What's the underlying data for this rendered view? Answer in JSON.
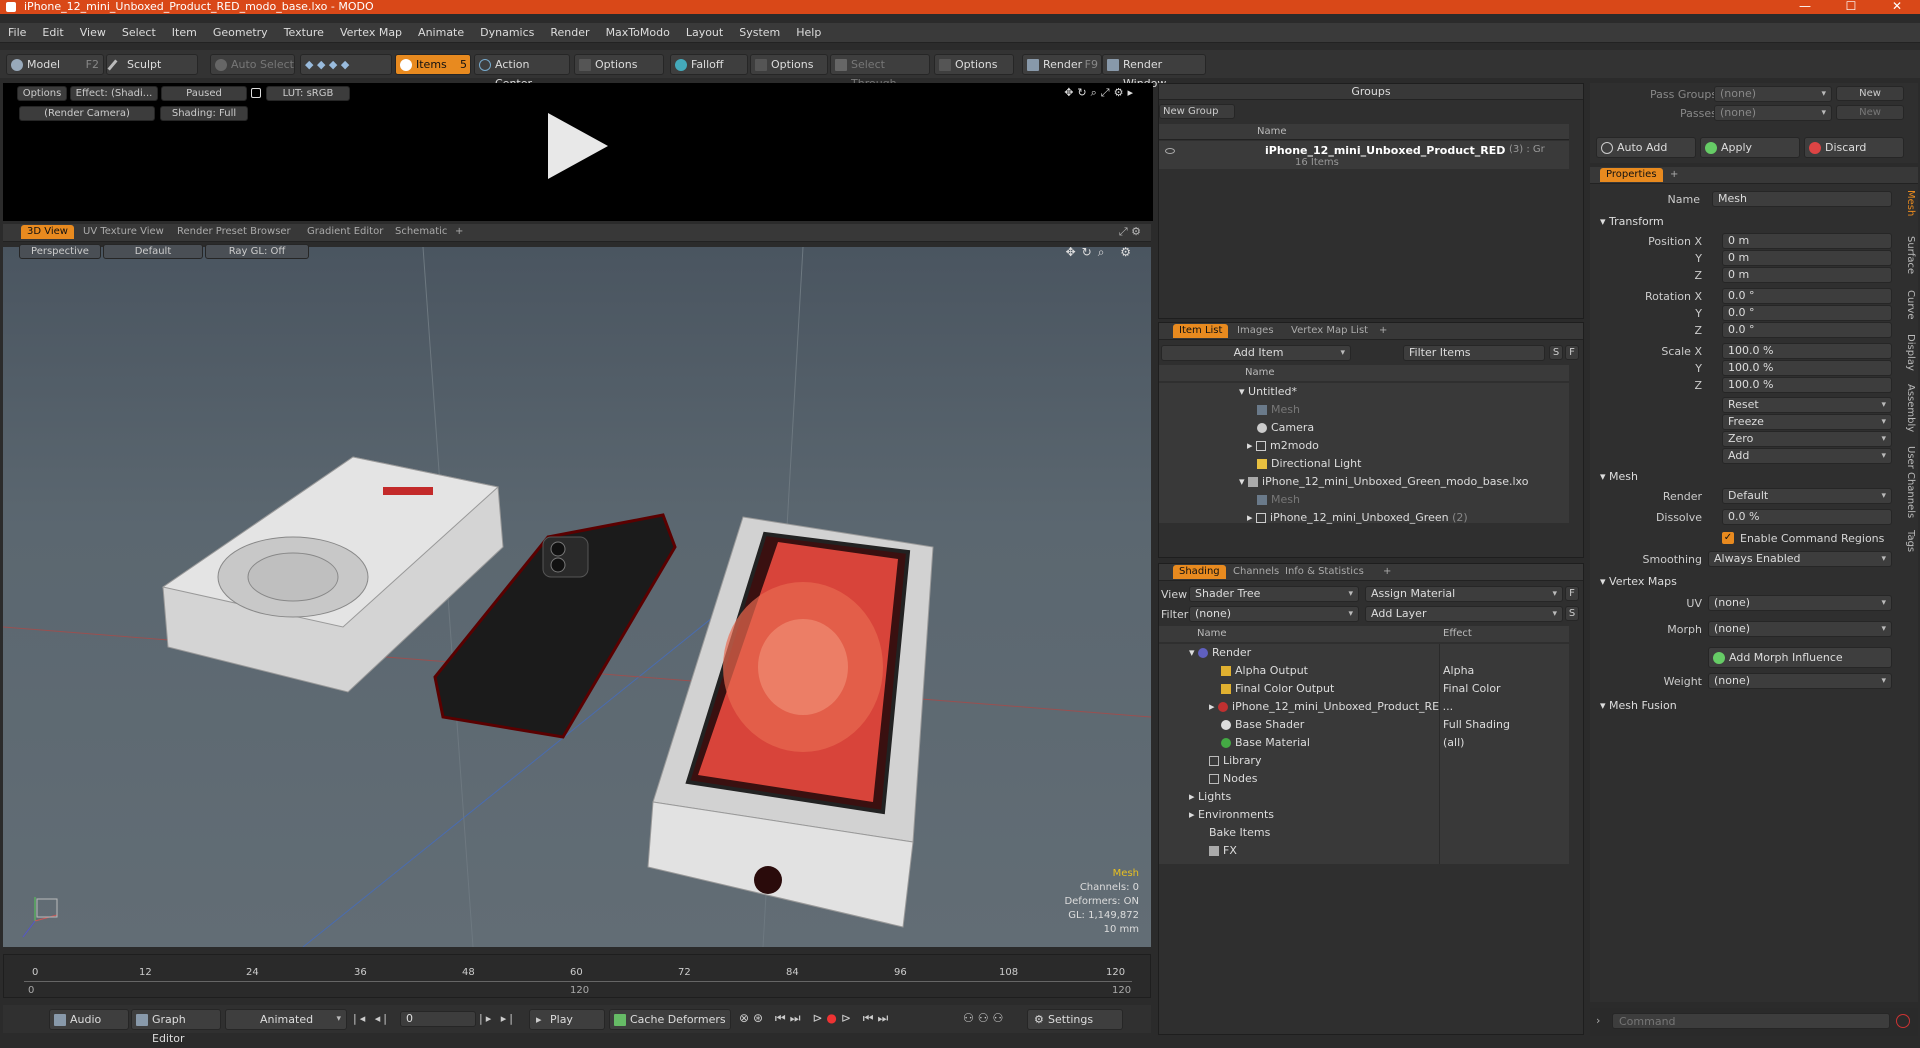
{
  "titlebar": {
    "title": "iPhone_12_mini_Unboxed_Product_RED_modo_base.lxo - MODO",
    "min": "—",
    "max": "☐",
    "close": "✕"
  },
  "menu": [
    "File",
    "Edit",
    "View",
    "Select",
    "Item",
    "Geometry",
    "Texture",
    "Vertex Map",
    "Animate",
    "Dynamics",
    "Render",
    "MaxToModo",
    "Layout",
    "System",
    "Help"
  ],
  "toolbar": {
    "model": "Model",
    "model_key": "F2",
    "sculpt": "Sculpt",
    "auto_select": "Auto Select",
    "items": "Items",
    "items_key": "5",
    "action_center": "Action Center",
    "options1": "Options",
    "falloff": "Falloff",
    "options2": "Options",
    "select_through": "Select Through",
    "options3": "Options",
    "render": "Render",
    "render_key": "F9",
    "render_window": "Render Window"
  },
  "preview": {
    "options": "Options",
    "effect": "Effect: (Shadi...",
    "paused": "Paused",
    "lut": "LUT: sRGB",
    "camera": "(Render Camera)",
    "shading": "Shading: Full"
  },
  "viewtabs": [
    "3D View",
    "UV Texture View",
    "Render Preset Browser",
    "Gradient Editor",
    "Schematic",
    "+"
  ],
  "viewport": {
    "perspective": "Perspective",
    "default": "Default",
    "raygl": "Ray GL: Off",
    "info_title": "Mesh",
    "channels": "Channels: 0",
    "deformers": "Deformers: ON",
    "gl": "GL: 1,149,872",
    "scale": "10 mm"
  },
  "timeline": {
    "ticks": [
      "0",
      "12",
      "24",
      "36",
      "48",
      "60",
      "72",
      "84",
      "96",
      "108",
      "120"
    ],
    "start": "0",
    "mid": "120",
    "end": "120"
  },
  "bottombar": {
    "audio": "Audio",
    "graph_editor": "Graph Editor",
    "animated": "Animated",
    "frame": "0",
    "play": "Play",
    "cache": "Cache Deformers",
    "settings": "Settings"
  },
  "groups": {
    "title": "Groups",
    "new_group": "New Group",
    "col_name": "Name",
    "item_name": "iPhone_12_mini_Unboxed_Product_RED",
    "item_suffix": "(3) : Gr",
    "item_count": "16 Items"
  },
  "itemlist": {
    "tabs": [
      "Item List",
      "Images",
      "Vertex Map List",
      "+"
    ],
    "add_item": "Add Item",
    "filter": "Filter Items",
    "s": "S",
    "f": "F",
    "col_name": "Name",
    "rows": [
      "Untitled*",
      "Mesh",
      "Camera",
      "m2modo",
      "Directional Light",
      "iPhone_12_mini_Unboxed_Green_modo_base.lxo",
      "Mesh",
      "iPhone_12_mini_Unboxed_Green"
    ],
    "green_suffix": "(2)"
  },
  "shading": {
    "tabs": [
      "Shading",
      "Channels",
      "Info & Statistics",
      "+"
    ],
    "view_lbl": "View",
    "view_val": "Shader Tree",
    "assign": "Assign Material",
    "f": "F",
    "filter_lbl": "Filter",
    "filter_val": "(none)",
    "add_layer": "Add Layer",
    "s": "S",
    "col_name": "Name",
    "col_effect": "Effect",
    "rows": [
      {
        "name": "Render",
        "effect": ""
      },
      {
        "name": "Alpha Output",
        "effect": "Alpha"
      },
      {
        "name": "Final Color Output",
        "effect": "Final Color"
      },
      {
        "name": "iPhone_12_mini_Unboxed_Product_RE ...",
        "effect": ""
      },
      {
        "name": "Base Shader",
        "effect": "Full Shading"
      },
      {
        "name": "Base Material",
        "effect": "(all)"
      },
      {
        "name": "Library",
        "effect": ""
      },
      {
        "name": "Nodes",
        "effect": ""
      },
      {
        "name": "Lights",
        "effect": ""
      },
      {
        "name": "Environments",
        "effect": ""
      },
      {
        "name": "Bake Items",
        "effect": ""
      },
      {
        "name": "FX",
        "effect": ""
      }
    ]
  },
  "passes": {
    "pass_groups": "Pass Groups",
    "pass_val": "(none)",
    "new": "New",
    "passes": "Passes",
    "passes_val": "(none)",
    "new2": "New",
    "auto_add": "Auto Add",
    "apply": "Apply",
    "discard": "Discard"
  },
  "properties": {
    "tab": "Properties",
    "plus": "+",
    "name_lbl": "Name",
    "name_val": "Mesh",
    "transform": "Transform",
    "position_x_lbl": "Position X",
    "y_lbl": "Y",
    "z_lbl": "Z",
    "pos": [
      "0 m",
      "0 m",
      "0 m"
    ],
    "rotation_x_lbl": "Rotation X",
    "rot": [
      "0.0 °",
      "0.0 °",
      "0.0 °"
    ],
    "scale_x_lbl": "Scale X",
    "scl": [
      "100.0 %",
      "100.0 %",
      "100.0 %"
    ],
    "reset": "Reset",
    "freeze": "Freeze",
    "zero": "Zero",
    "add": "Add",
    "mesh": "Mesh",
    "render_lbl": "Render",
    "render_val": "Default",
    "dissolve_lbl": "Dissolve",
    "dissolve_val": "0.0 %",
    "enable_cmd": "Enable Command Regions",
    "smoothing_lbl": "Smoothing",
    "smoothing_val": "Always Enabled",
    "vertex_maps": "Vertex Maps",
    "uv_lbl": "UV",
    "uv_val": "(none)",
    "morph_lbl": "Morph",
    "morph_val": "(none)",
    "add_morph": "Add Morph Influence",
    "weight_lbl": "Weight",
    "weight_val": "(none)",
    "mesh_fusion": "Mesh Fusion",
    "side_tabs": [
      "Mesh",
      "Surface",
      "Curve",
      "Display",
      "Assembly",
      "User Channels",
      "Tags"
    ]
  },
  "command": {
    "placeholder": "Command"
  },
  "colors": {
    "accent": "#e88a1f",
    "titlebar": "#d94818"
  }
}
